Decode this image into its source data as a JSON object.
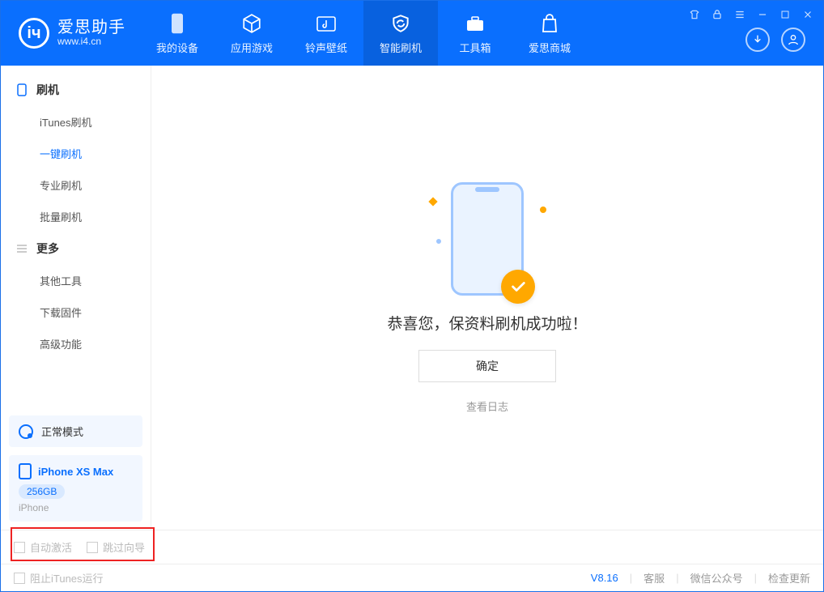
{
  "app": {
    "name_cn": "爱思助手",
    "name_en": "www.i4.cn"
  },
  "nav": {
    "items": [
      {
        "label": "我的设备"
      },
      {
        "label": "应用游戏"
      },
      {
        "label": "铃声壁纸"
      },
      {
        "label": "智能刷机"
      },
      {
        "label": "工具箱"
      },
      {
        "label": "爱思商城"
      }
    ],
    "active_index": 3
  },
  "sidebar": {
    "groups": [
      {
        "title": "刷机",
        "items": [
          "iTunes刷机",
          "一键刷机",
          "专业刷机",
          "批量刷机"
        ],
        "active_index": 1
      },
      {
        "title": "更多",
        "items": [
          "其他工具",
          "下载固件",
          "高级功能"
        ],
        "active_index": -1
      }
    ],
    "mode": "正常模式",
    "device": {
      "name": "iPhone XS Max",
      "storage": "256GB",
      "type": "iPhone"
    }
  },
  "main": {
    "success_text": "恭喜您，保资料刷机成功啦！",
    "ok_button": "确定",
    "view_log": "查看日志"
  },
  "footer_top": {
    "auto_activate": "自动激活",
    "skip_guide": "跳过向导"
  },
  "statusbar": {
    "prevent_itunes": "阻止iTunes运行",
    "version": "V8.16",
    "support": "客服",
    "wechat": "微信公众号",
    "check_update": "检查更新"
  }
}
